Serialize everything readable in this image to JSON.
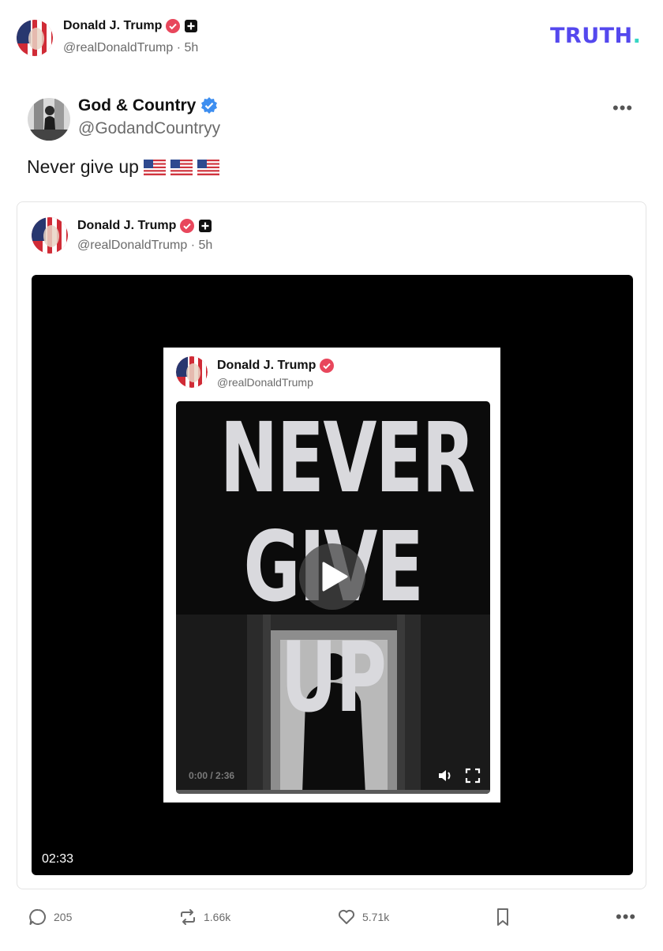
{
  "header": {
    "name": "Donald J. Trump",
    "handle": "@realDonaldTrump",
    "time": "· 5h",
    "brand": "TRUTH",
    "brand_dot": "."
  },
  "post": {
    "author_name": "God & Country",
    "author_handle": "@GodandCountryy",
    "text": "Never give up",
    "flags": [
      "us-flag",
      "us-flag",
      "us-flag"
    ]
  },
  "quote": {
    "name": "Donald J. Trump",
    "handle": "@realDonaldTrump",
    "time": "· 5h",
    "video_duration": "02:33"
  },
  "inner_card": {
    "name": "Donald J. Trump",
    "handle": "@realDonaldTrump",
    "video_line1": "NEVER",
    "video_line2": "GIVE UP",
    "video_time": "0:00 / 2:36",
    "progress": 0
  },
  "actions": {
    "replies": "205",
    "retruths": "1.66k",
    "likes": "5.71k"
  },
  "colors": {
    "brand": "#5448ee",
    "brand_dot": "#38d6c4",
    "verified_red": "#e8475c",
    "verified_blue": "#3d8ef0"
  }
}
